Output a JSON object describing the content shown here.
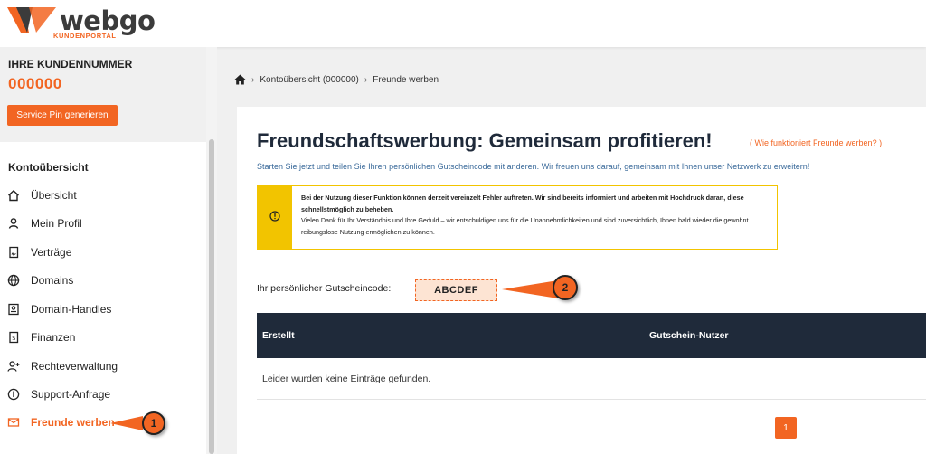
{
  "brand": {
    "name": "webgo",
    "subtitle": "KUNDENPORTAL",
    "color": "#f26522"
  },
  "sidebar": {
    "customer_label": "IHRE KUNDENNUMMER",
    "customer_number": "000000",
    "pin_button": "Service Pin generieren",
    "section_title": "Kontoübersicht",
    "items": [
      {
        "label": "Übersicht",
        "icon": "home-icon"
      },
      {
        "label": "Mein Profil",
        "icon": "user-icon"
      },
      {
        "label": "Verträge",
        "icon": "contract-icon"
      },
      {
        "label": "Domains",
        "icon": "globe-icon"
      },
      {
        "label": "Domain-Handles",
        "icon": "id-card-icon"
      },
      {
        "label": "Finanzen",
        "icon": "invoice-icon"
      },
      {
        "label": "Rechteverwaltung",
        "icon": "user-plus-icon"
      },
      {
        "label": "Support-Anfrage",
        "icon": "info-icon"
      },
      {
        "label": "Freunde werben",
        "icon": "mail-icon",
        "active": true
      }
    ]
  },
  "breadcrumb": {
    "items": [
      "Kontoübersicht (000000)",
      "Freunde werben"
    ]
  },
  "main": {
    "title": "Freundschaftswerbung: Gemeinsam profitieren!",
    "help_link": "( Wie funktioniert Freunde werben? )",
    "subtitle": "Starten Sie jetzt und teilen Sie Ihren persönlichen Gutscheincode mit anderen. Wir freuen uns darauf, gemeinsam mit Ihnen unser Netzwerk zu erweitern!",
    "warning_bold": "Bei der Nutzung dieser Funktion können derzeit vereinzelt Fehler auftreten. Wir sind bereits informiert und arbeiten mit Hochdruck daran, diese schnellstmöglich zu beheben.",
    "warning_text": "Vielen Dank für Ihr Verständnis und Ihre Geduld – wir entschuldigen uns für die Unannehmlichkeiten und sind zuversichtlich, Ihnen bald wieder die gewohnt reibungslose Nutzung ermöglichen zu können.",
    "code_label": "Ihr persönlicher Gutscheincode:",
    "code_value": "ABCDEF",
    "table": {
      "columns": [
        "Erstellt",
        "Gutschein-Nutzer"
      ],
      "empty_message": "Leider wurden keine Einträge gefunden."
    },
    "pagination": {
      "current_page": "1"
    }
  },
  "annotations": [
    {
      "number": "1"
    },
    {
      "number": "2"
    }
  ]
}
